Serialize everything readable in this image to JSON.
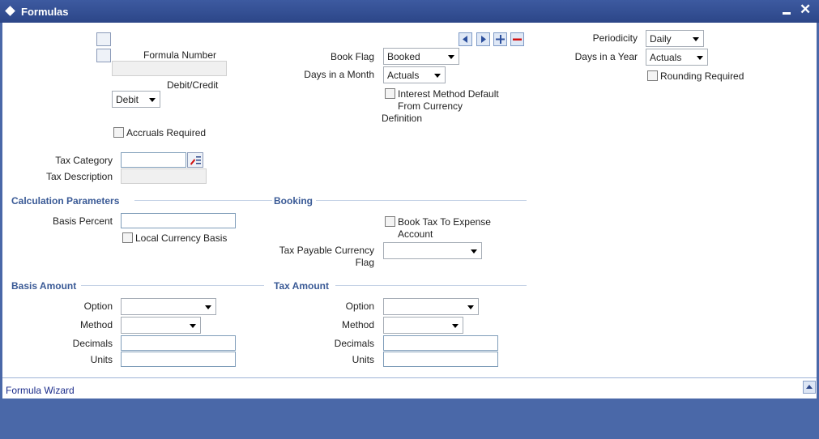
{
  "window": {
    "title": "Formulas",
    "minimize": "‒",
    "close": "✕"
  },
  "header": {
    "formula_number_label": "Formula Number",
    "debit_credit_label": "Debit/Credit",
    "debit_credit_value": "Debit",
    "accruals_label": "Accruals Required",
    "book_flag_label": "Book Flag",
    "book_flag_value": "Booked",
    "days_month_label": "Days in a Month",
    "days_month_value": "Actuals",
    "interest_method_line1": "Interest Method Default",
    "interest_method_line2": "From Currency",
    "interest_method_line3": "Definition",
    "periodicity_label": "Periodicity",
    "periodicity_value": "Daily",
    "days_year_label": "Days in a Year",
    "days_year_value": "Actuals",
    "rounding_label": "Rounding Required",
    "tax_category_label": "Tax Category",
    "tax_description_label": "Tax Description"
  },
  "calc": {
    "section": "Calculation Parameters",
    "basis_percent_label": "Basis Percent",
    "local_currency_label": "Local Currency Basis"
  },
  "booking": {
    "section": "Booking",
    "book_tax_line1": "Book Tax To Expense",
    "book_tax_line2": "Account",
    "tax_payable_line1": "Tax Payable Currency",
    "tax_payable_line2": "Flag"
  },
  "basis_amount": {
    "section": "Basis Amount",
    "option_label": "Option",
    "method_label": "Method",
    "decimals_label": "Decimals",
    "units_label": "Units"
  },
  "tax_amount": {
    "section": "Tax Amount",
    "option_label": "Option",
    "method_label": "Method",
    "decimals_label": "Decimals",
    "units_label": "Units"
  },
  "footer": {
    "link": "Formula Wizard"
  },
  "colors": {
    "titlebar": "#2c4688",
    "section": "#3a5a96",
    "background": "#4a68a8"
  }
}
